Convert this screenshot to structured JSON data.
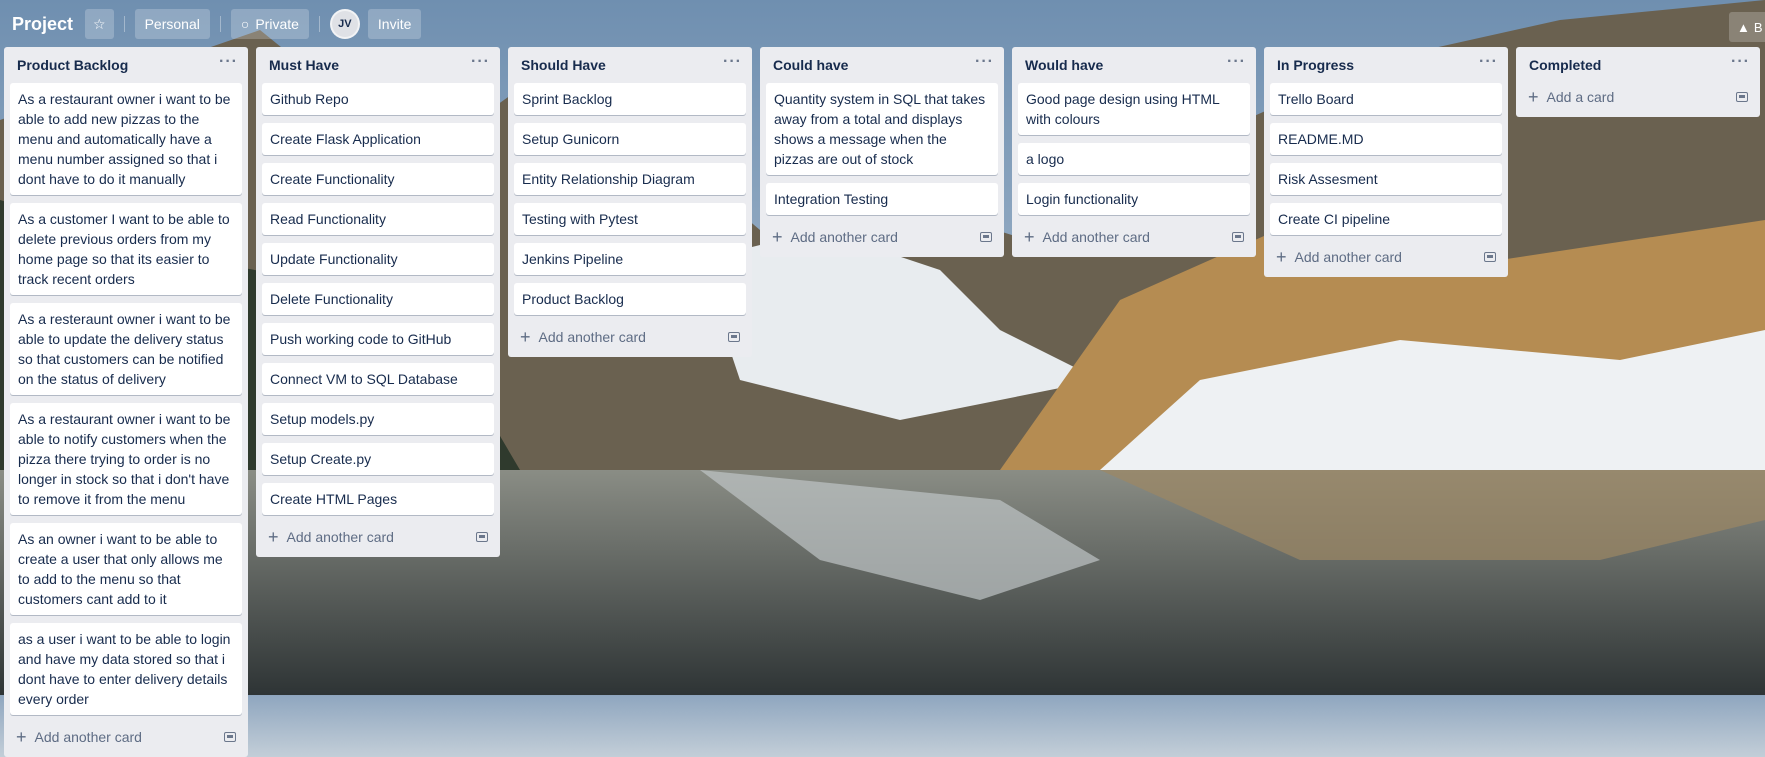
{
  "header": {
    "board_title": "Project",
    "workspace_label": "Personal",
    "visibility_label": "Private",
    "member_initials": "JV",
    "invite_label": "Invite",
    "right_label": "B"
  },
  "lists": [
    {
      "title": "Product Backlog",
      "cards": [
        "As a restaurant owner i want to be able to add new pizzas to the menu and automatically have a menu number assigned so that i dont have to do it manually",
        "As a customer I want to be able to delete previous orders from my home page so that its easier to track recent orders",
        "As a resteraunt owner i want to be able to update the delivery status so that customers can be notified on the status of delivery",
        "As a restaurant owner i want to be able to notify customers when the pizza there trying to order is no longer in stock so that i don't have to remove it from the menu",
        "As an owner i want to be able to create a user that only allows me to add to the menu so that customers cant add to it",
        "as a user i want to be able to login and have my data stored so that i dont have to enter delivery details every order"
      ],
      "footer": "Add another card"
    },
    {
      "title": "Must Have",
      "cards": [
        "Github Repo",
        "Create Flask Application",
        "Create Functionality",
        "Read Functionality",
        "Update Functionality",
        "Delete Functionality",
        "Push working code to GitHub",
        "Connect VM to SQL Database",
        "Setup models.py",
        "Setup Create.py",
        "Create HTML Pages"
      ],
      "footer": "Add another card"
    },
    {
      "title": "Should Have",
      "cards": [
        "Sprint Backlog",
        "Setup Gunicorn",
        "Entity Relationship Diagram",
        "Testing with Pytest",
        "Jenkins Pipeline",
        "Product Backlog"
      ],
      "footer": "Add another card"
    },
    {
      "title": "Could have",
      "cards": [
        "Quantity system in SQL that takes away from a total and displays shows a message when the pizzas are out of stock",
        "Integration Testing"
      ],
      "footer": "Add another card"
    },
    {
      "title": "Would have",
      "cards": [
        "Good page design using HTML with colours",
        "a logo",
        "Login functionality"
      ],
      "footer": "Add another card"
    },
    {
      "title": "In Progress",
      "cards": [
        "Trello Board",
        "README.MD",
        "Risk Assesment",
        "Create CI pipeline"
      ],
      "footer": "Add another card"
    },
    {
      "title": "Completed",
      "cards": [],
      "footer": "Add a card"
    }
  ]
}
